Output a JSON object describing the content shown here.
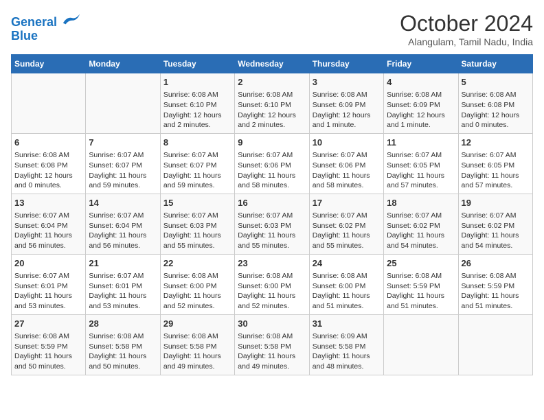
{
  "logo": {
    "line1": "General",
    "line2": "Blue"
  },
  "title": "October 2024",
  "subtitle": "Alangulam, Tamil Nadu, India",
  "days_of_week": [
    "Sunday",
    "Monday",
    "Tuesday",
    "Wednesday",
    "Thursday",
    "Friday",
    "Saturday"
  ],
  "weeks": [
    [
      {
        "day": "",
        "info": ""
      },
      {
        "day": "",
        "info": ""
      },
      {
        "day": "1",
        "info": "Sunrise: 6:08 AM\nSunset: 6:10 PM\nDaylight: 12 hours and 2 minutes."
      },
      {
        "day": "2",
        "info": "Sunrise: 6:08 AM\nSunset: 6:10 PM\nDaylight: 12 hours and 2 minutes."
      },
      {
        "day": "3",
        "info": "Sunrise: 6:08 AM\nSunset: 6:09 PM\nDaylight: 12 hours and 1 minute."
      },
      {
        "day": "4",
        "info": "Sunrise: 6:08 AM\nSunset: 6:09 PM\nDaylight: 12 hours and 1 minute."
      },
      {
        "day": "5",
        "info": "Sunrise: 6:08 AM\nSunset: 6:08 PM\nDaylight: 12 hours and 0 minutes."
      }
    ],
    [
      {
        "day": "6",
        "info": "Sunrise: 6:08 AM\nSunset: 6:08 PM\nDaylight: 12 hours and 0 minutes."
      },
      {
        "day": "7",
        "info": "Sunrise: 6:07 AM\nSunset: 6:07 PM\nDaylight: 11 hours and 59 minutes."
      },
      {
        "day": "8",
        "info": "Sunrise: 6:07 AM\nSunset: 6:07 PM\nDaylight: 11 hours and 59 minutes."
      },
      {
        "day": "9",
        "info": "Sunrise: 6:07 AM\nSunset: 6:06 PM\nDaylight: 11 hours and 58 minutes."
      },
      {
        "day": "10",
        "info": "Sunrise: 6:07 AM\nSunset: 6:06 PM\nDaylight: 11 hours and 58 minutes."
      },
      {
        "day": "11",
        "info": "Sunrise: 6:07 AM\nSunset: 6:05 PM\nDaylight: 11 hours and 57 minutes."
      },
      {
        "day": "12",
        "info": "Sunrise: 6:07 AM\nSunset: 6:05 PM\nDaylight: 11 hours and 57 minutes."
      }
    ],
    [
      {
        "day": "13",
        "info": "Sunrise: 6:07 AM\nSunset: 6:04 PM\nDaylight: 11 hours and 56 minutes."
      },
      {
        "day": "14",
        "info": "Sunrise: 6:07 AM\nSunset: 6:04 PM\nDaylight: 11 hours and 56 minutes."
      },
      {
        "day": "15",
        "info": "Sunrise: 6:07 AM\nSunset: 6:03 PM\nDaylight: 11 hours and 55 minutes."
      },
      {
        "day": "16",
        "info": "Sunrise: 6:07 AM\nSunset: 6:03 PM\nDaylight: 11 hours and 55 minutes."
      },
      {
        "day": "17",
        "info": "Sunrise: 6:07 AM\nSunset: 6:02 PM\nDaylight: 11 hours and 55 minutes."
      },
      {
        "day": "18",
        "info": "Sunrise: 6:07 AM\nSunset: 6:02 PM\nDaylight: 11 hours and 54 minutes."
      },
      {
        "day": "19",
        "info": "Sunrise: 6:07 AM\nSunset: 6:02 PM\nDaylight: 11 hours and 54 minutes."
      }
    ],
    [
      {
        "day": "20",
        "info": "Sunrise: 6:07 AM\nSunset: 6:01 PM\nDaylight: 11 hours and 53 minutes."
      },
      {
        "day": "21",
        "info": "Sunrise: 6:07 AM\nSunset: 6:01 PM\nDaylight: 11 hours and 53 minutes."
      },
      {
        "day": "22",
        "info": "Sunrise: 6:08 AM\nSunset: 6:00 PM\nDaylight: 11 hours and 52 minutes."
      },
      {
        "day": "23",
        "info": "Sunrise: 6:08 AM\nSunset: 6:00 PM\nDaylight: 11 hours and 52 minutes."
      },
      {
        "day": "24",
        "info": "Sunrise: 6:08 AM\nSunset: 6:00 PM\nDaylight: 11 hours and 51 minutes."
      },
      {
        "day": "25",
        "info": "Sunrise: 6:08 AM\nSunset: 5:59 PM\nDaylight: 11 hours and 51 minutes."
      },
      {
        "day": "26",
        "info": "Sunrise: 6:08 AM\nSunset: 5:59 PM\nDaylight: 11 hours and 51 minutes."
      }
    ],
    [
      {
        "day": "27",
        "info": "Sunrise: 6:08 AM\nSunset: 5:59 PM\nDaylight: 11 hours and 50 minutes."
      },
      {
        "day": "28",
        "info": "Sunrise: 6:08 AM\nSunset: 5:58 PM\nDaylight: 11 hours and 50 minutes."
      },
      {
        "day": "29",
        "info": "Sunrise: 6:08 AM\nSunset: 5:58 PM\nDaylight: 11 hours and 49 minutes."
      },
      {
        "day": "30",
        "info": "Sunrise: 6:08 AM\nSunset: 5:58 PM\nDaylight: 11 hours and 49 minutes."
      },
      {
        "day": "31",
        "info": "Sunrise: 6:09 AM\nSunset: 5:58 PM\nDaylight: 11 hours and 48 minutes."
      },
      {
        "day": "",
        "info": ""
      },
      {
        "day": "",
        "info": ""
      }
    ]
  ]
}
